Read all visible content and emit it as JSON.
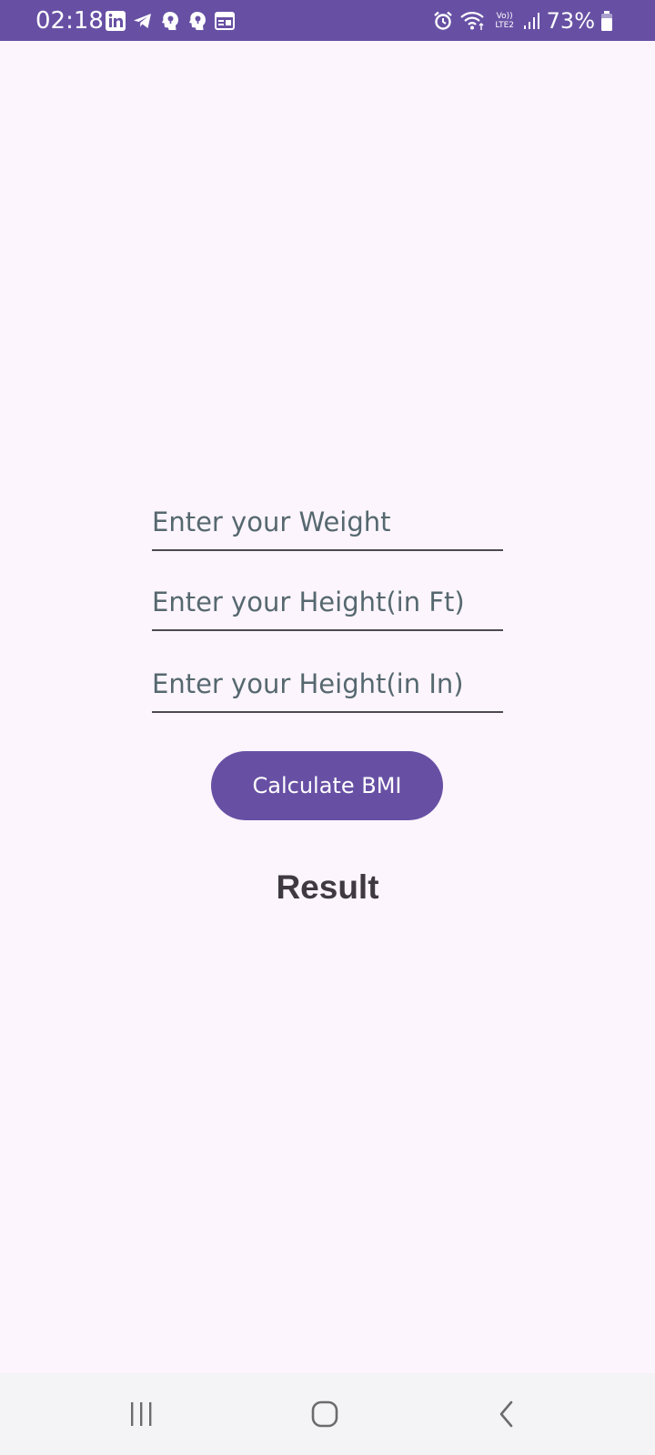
{
  "status_bar": {
    "time": "02:18",
    "network_label_top": "Vo))",
    "network_label_bottom": "LTE2",
    "battery_percent": "73%",
    "icons": [
      "linkedin-icon",
      "telegram-icon",
      "app-head-icon",
      "app-head-icon",
      "calendar-icon",
      "alarm-icon",
      "wifi-icon",
      "signal-icon",
      "battery-icon"
    ],
    "background_color": "#6750a4"
  },
  "form": {
    "weight_placeholder": "Enter your Weight",
    "height_ft_placeholder": "Enter your Height(in Ft)",
    "height_in_placeholder": "Enter your Height(in In)",
    "calculate_label": "Calculate BMI",
    "result_label": "Result"
  },
  "nav_bar": {
    "buttons": [
      "recents-icon",
      "home-icon",
      "back-icon"
    ]
  },
  "colors": {
    "accent": "#6750a4",
    "background": "#fcf5fd",
    "placeholder": "#56686f"
  }
}
